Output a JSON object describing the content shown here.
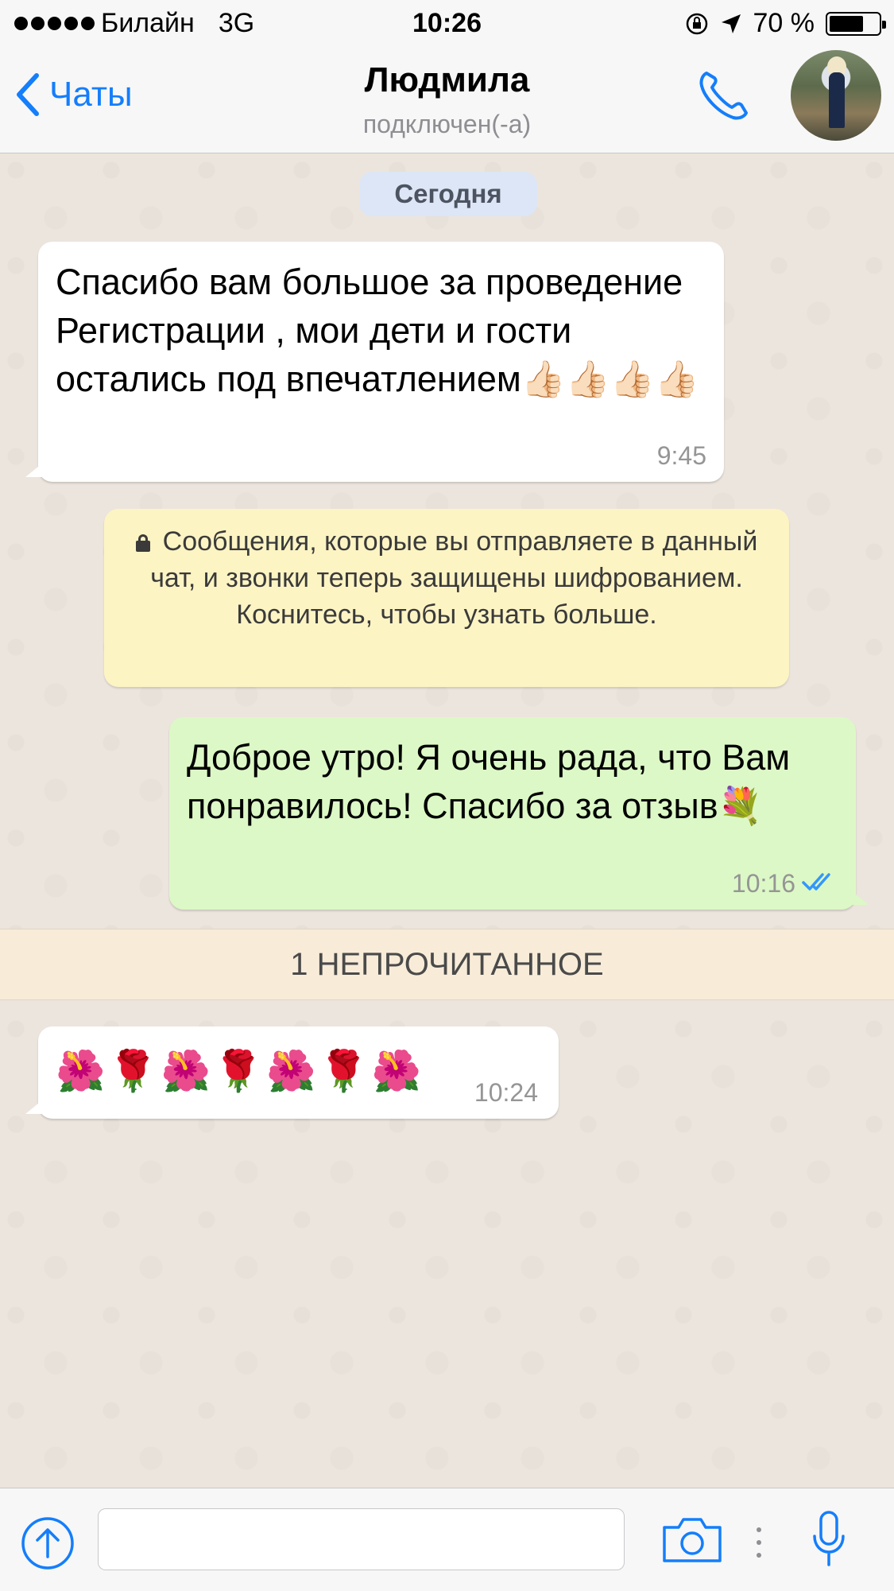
{
  "status_bar": {
    "carrier": "Билайн",
    "network": "3G",
    "time": "10:26",
    "battery": "70 %",
    "battery_level": 0.7
  },
  "nav": {
    "back_label": "Чаты",
    "title": "Людмила",
    "subtitle": "подключен(-а)",
    "icons": [
      "chevron-left-icon",
      "phone-icon",
      "avatar"
    ]
  },
  "chat": {
    "date_label": "Сегодня",
    "messages": [
      {
        "direction": "incoming",
        "text": "Спасибо вам большое за проведение Регистрации , мои дети и гости остались под впечатлением👍🏻👍🏻👍🏻👍🏻",
        "time": "9:45"
      },
      {
        "direction": "outgoing",
        "text": "Доброе утро! Я очень рада, что Вам понравилось! Спасибо за отзыв💐",
        "time": "10:16",
        "status": "read"
      },
      {
        "direction": "incoming",
        "text": "🌺🌹🌺🌹🌺🌹🌺",
        "time": "10:24"
      }
    ],
    "encryption_notice": "Сообщения, которые вы отправляете в данный чат, и звонки теперь защищены шифрованием. Коснитесь, чтобы узнать больше.",
    "unread_banner": "1 НЕПРОЧИТАННОЕ"
  },
  "input_bar": {
    "text_value": "",
    "icons": [
      "upload-icon",
      "camera-icon",
      "microphone-icon"
    ]
  },
  "colors": {
    "accent": "#147efb",
    "incoming_bubble": "#ffffff",
    "outgoing_bubble": "#dcf8c6",
    "chat_background": "#ece5dd",
    "encryption_bg": "#fdf4c4",
    "read_ticks": "#3497f9"
  }
}
